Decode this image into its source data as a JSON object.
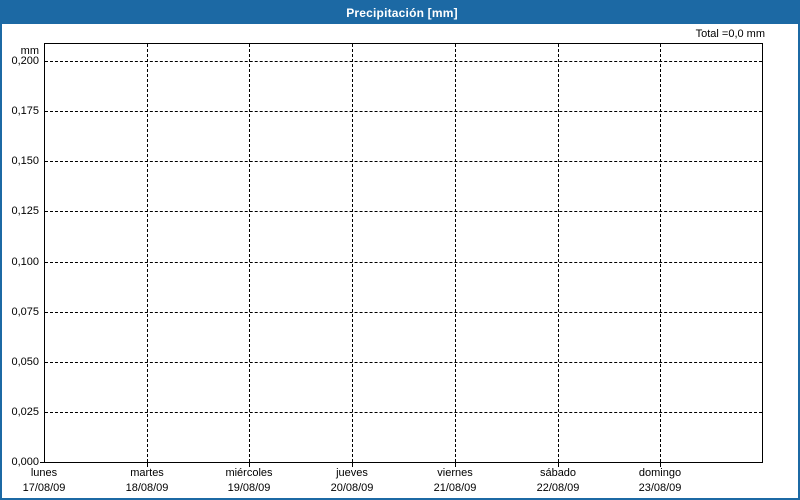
{
  "titlebar": {
    "title": "Precipitación [mm]"
  },
  "summary": {
    "total_label": "Total =0,0 mm"
  },
  "colors": {
    "accent_blue": "#1c69a4",
    "grid": "#000000",
    "background": "#ffffff",
    "text": "#000000"
  },
  "chart_data": {
    "type": "bar",
    "title": "Precipitación [mm]",
    "ylabel": "mm",
    "xlabel": "",
    "categories": [
      "lunes",
      "martes",
      "miércoles",
      "jueves",
      "viernes",
      "sábado",
      "domingo"
    ],
    "category_dates": [
      "17/08/09",
      "18/08/09",
      "19/08/09",
      "20/08/09",
      "21/08/09",
      "22/08/09",
      "23/08/09"
    ],
    "values": [
      0,
      0,
      0,
      0,
      0,
      0,
      0
    ],
    "total_label": "Total =0,0 mm",
    "total_value_mm": 0.0,
    "y_ticks": [
      {
        "value": 0.2,
        "label": "0,200"
      },
      {
        "value": 0.175,
        "label": "0,175"
      },
      {
        "value": 0.15,
        "label": "0,150"
      },
      {
        "value": 0.125,
        "label": "0,125"
      },
      {
        "value": 0.1,
        "label": "0,100"
      },
      {
        "value": 0.075,
        "label": "0,075"
      },
      {
        "value": 0.05,
        "label": "0,050"
      },
      {
        "value": 0.025,
        "label": "0,025"
      },
      {
        "value": 0.0,
        "label": "0,000"
      }
    ],
    "ylim": [
      0,
      0.2095
    ],
    "grid": true,
    "grid_style": "dashed",
    "legend_position": "none"
  }
}
